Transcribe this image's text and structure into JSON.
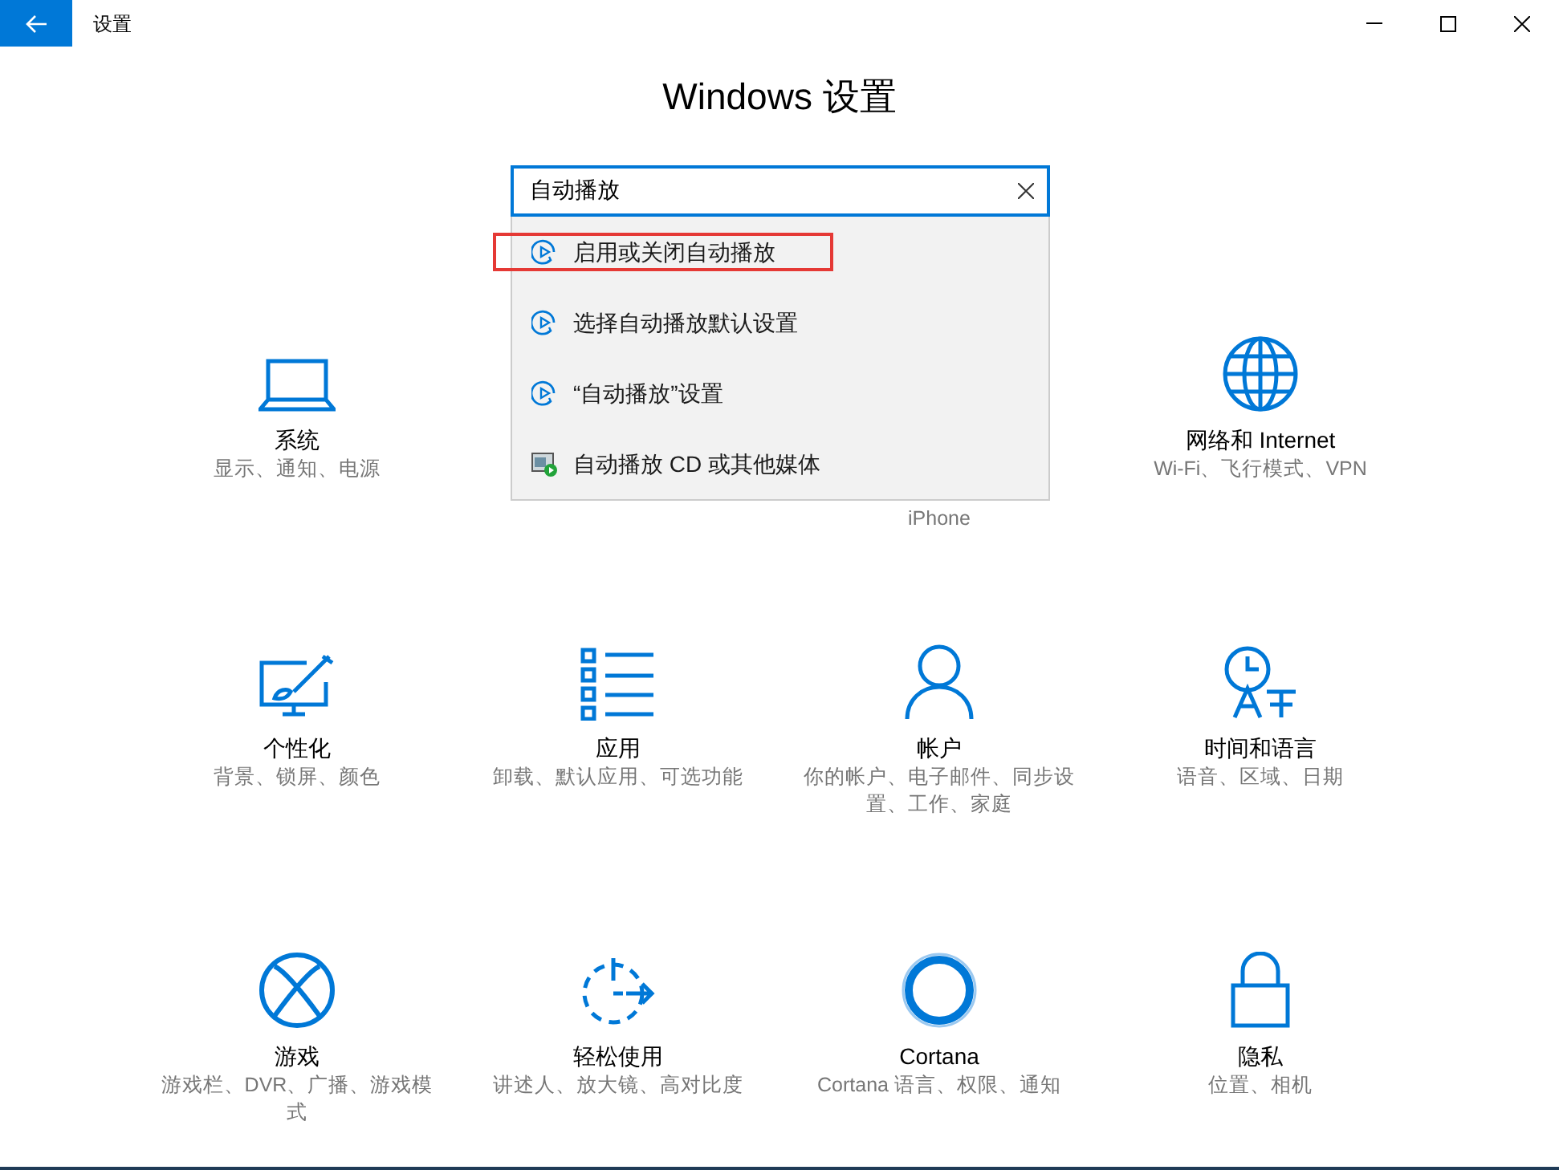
{
  "window": {
    "title": "设置"
  },
  "heading": "Windows 设置",
  "search": {
    "value": "自动播放"
  },
  "suggestions": [
    {
      "kind": "autoplay",
      "label": "启用或关闭自动播放",
      "highlighted": true
    },
    {
      "kind": "autoplay",
      "label": "选择自动播放默认设置",
      "highlighted": false
    },
    {
      "kind": "autoplay",
      "label": "“自动播放”设置",
      "highlighted": false
    },
    {
      "kind": "media",
      "label": "自动播放 CD 或其他媒体",
      "highlighted": false
    }
  ],
  "categories": [
    {
      "kind": "tile",
      "title": "系统",
      "subtitle": "显示、通知、电源"
    },
    {
      "kind": "covered"
    },
    {
      "kind": "covered",
      "subtitle": "iPhone"
    },
    {
      "kind": "tile",
      "title": "网络和 Internet",
      "subtitle": "Wi-Fi、飞行模式、VPN"
    },
    {
      "kind": "tile",
      "title": "个性化",
      "subtitle": "背景、锁屏、颜色"
    },
    {
      "kind": "tile",
      "title": "应用",
      "subtitle": "卸载、默认应用、可选功能"
    },
    {
      "kind": "tile",
      "title": "帐户",
      "subtitle": "你的帐户、电子邮件、同步设置、工作、家庭"
    },
    {
      "kind": "tile",
      "title": "时间和语言",
      "subtitle": "语音、区域、日期"
    },
    {
      "kind": "tile",
      "title": "游戏",
      "subtitle": "游戏栏、DVR、广播、游戏模式"
    },
    {
      "kind": "tile",
      "title": "轻松使用",
      "subtitle": "讲述人、放大镜、高对比度"
    },
    {
      "kind": "tile",
      "title": "Cortana",
      "subtitle": "Cortana 语言、权限、通知"
    },
    {
      "kind": "tile",
      "title": "隐私",
      "subtitle": "位置、相机"
    }
  ]
}
